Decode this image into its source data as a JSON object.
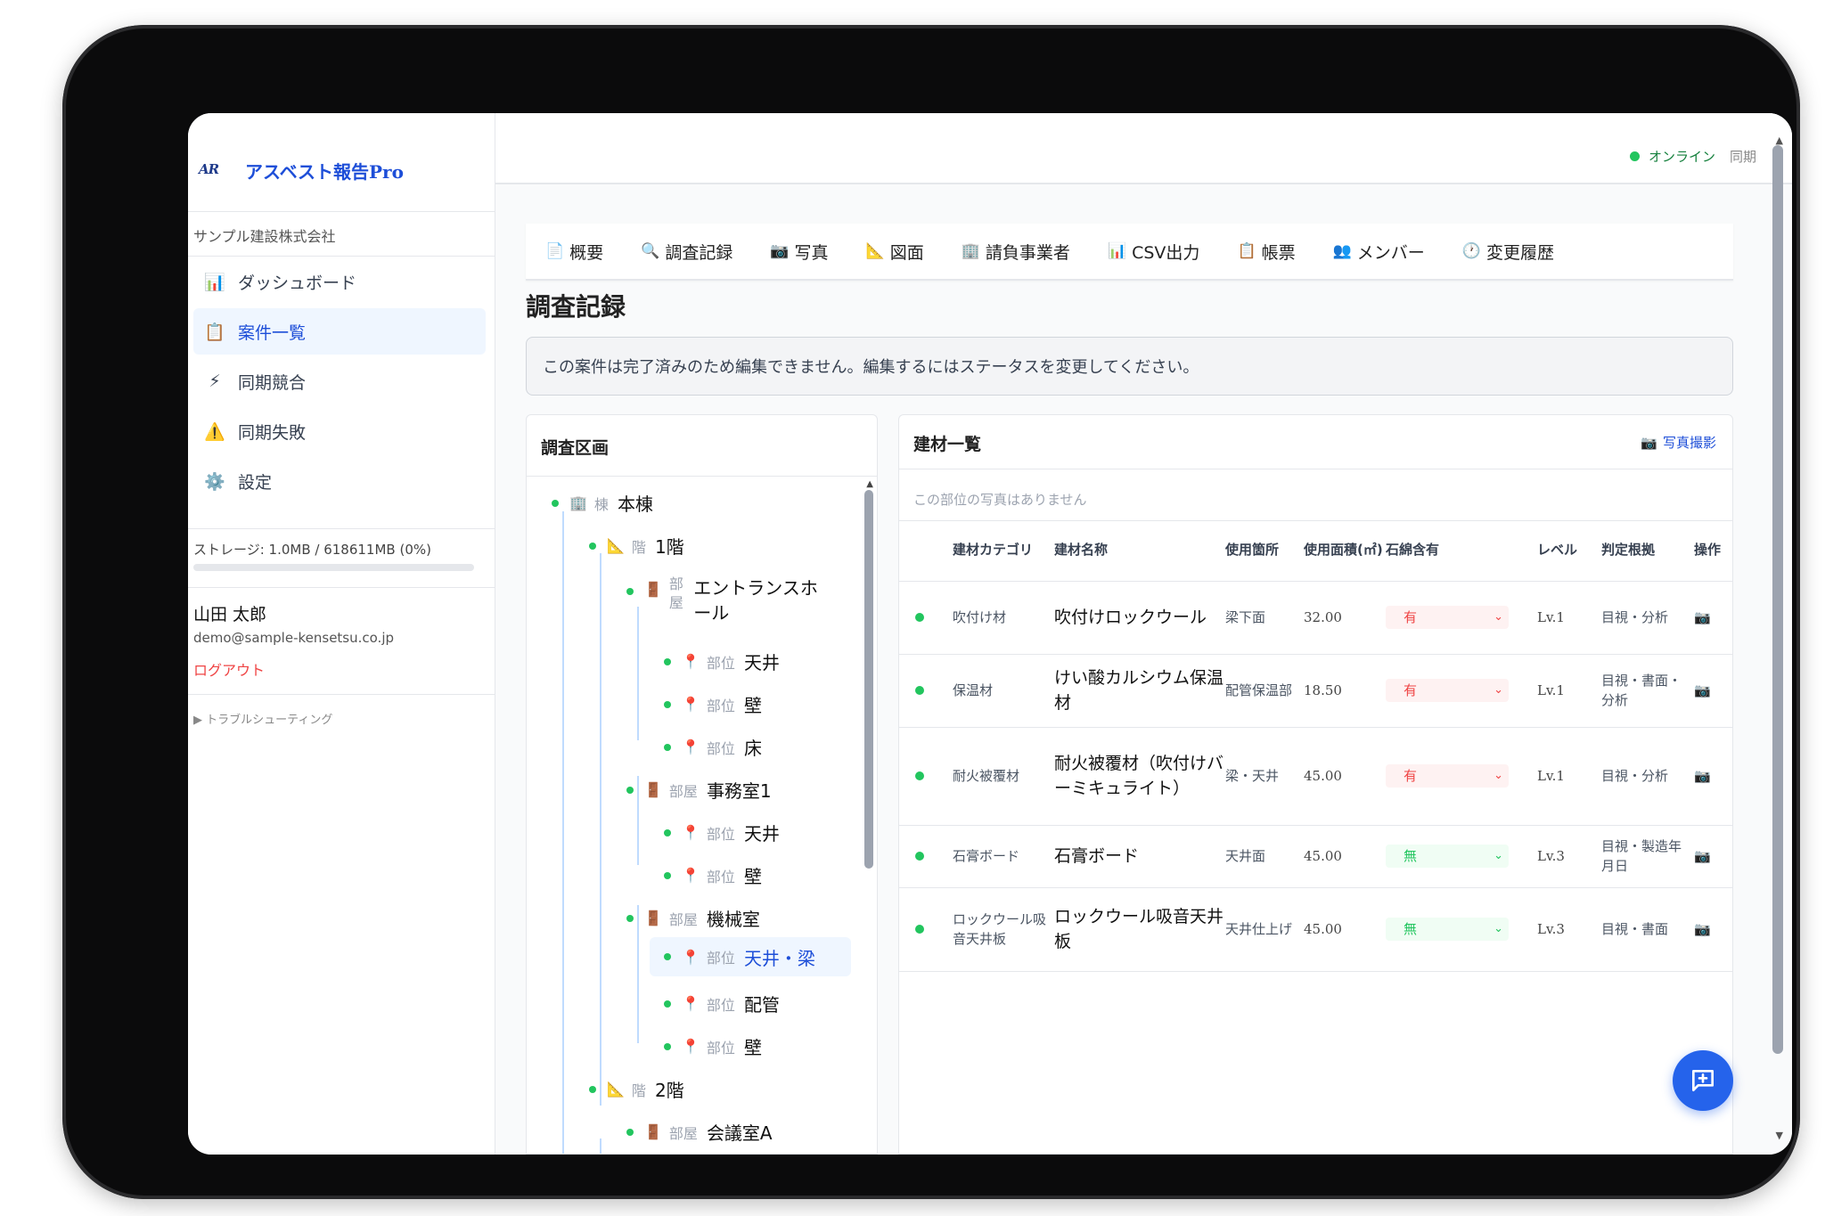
{
  "app": {
    "brand_logo": "AR",
    "brand_name": "アスベスト報告Pro",
    "company": "サンプル建設株式会社"
  },
  "sidebar": {
    "items": [
      {
        "icon": "📊",
        "label": "ダッシュボード"
      },
      {
        "icon": "📋",
        "label": "案件一覧"
      },
      {
        "icon": "⚡",
        "label": "同期競合"
      },
      {
        "icon": "⚠️",
        "label": "同期失敗"
      },
      {
        "icon": "⚙️",
        "label": "設定"
      }
    ],
    "storage": "ストレージ: 1.0MB / 618611MB (0%)",
    "storage_pct": 0,
    "user_name": "山田 太郎",
    "user_email": "demo@sample-kensetsu.co.jp",
    "logout": "ログアウト",
    "troubleshooting": "▶ トラブルシューティング"
  },
  "status": {
    "online": "オンライン",
    "sync": "同期"
  },
  "tabs": [
    {
      "icon": "📄",
      "label": "概要"
    },
    {
      "icon": "🔍",
      "label": "調査記録"
    },
    {
      "icon": "📷",
      "label": "写真"
    },
    {
      "icon": "📐",
      "label": "図面"
    },
    {
      "icon": "🏢",
      "label": "請負事業者"
    },
    {
      "icon": "📊",
      "label": "CSV出力"
    },
    {
      "icon": "📋",
      "label": "帳票"
    },
    {
      "icon": "👥",
      "label": "メンバー"
    },
    {
      "icon": "🕐",
      "label": "変更履歴"
    }
  ],
  "page": {
    "title": "調査記録",
    "notice": "この案件は完了済みのため編集できません。編集するにはステータスを変更してください。"
  },
  "tree": {
    "title": "調査区画",
    "nodes": [
      {
        "icon": "🏢",
        "type": "棟",
        "label": "本棟"
      },
      {
        "icon": "📐",
        "type": "階",
        "label": "1階"
      },
      {
        "icon": "🚪",
        "type": "部屋",
        "label": "エントランスホール"
      },
      {
        "icon": "📍",
        "type": "部位",
        "label": "天井"
      },
      {
        "icon": "📍",
        "type": "部位",
        "label": "壁"
      },
      {
        "icon": "📍",
        "type": "部位",
        "label": "床"
      },
      {
        "icon": "🚪",
        "type": "部屋",
        "label": "事務室1"
      },
      {
        "icon": "📍",
        "type": "部位",
        "label": "天井"
      },
      {
        "icon": "📍",
        "type": "部位",
        "label": "壁"
      },
      {
        "icon": "🚪",
        "type": "部屋",
        "label": "機械室"
      },
      {
        "icon": "📍",
        "type": "部位",
        "label": "天井・梁"
      },
      {
        "icon": "📍",
        "type": "部位",
        "label": "配管"
      },
      {
        "icon": "📍",
        "type": "部位",
        "label": "壁"
      },
      {
        "icon": "📐",
        "type": "階",
        "label": "2階"
      },
      {
        "icon": "🚪",
        "type": "部屋",
        "label": "会議室A"
      }
    ]
  },
  "materials": {
    "title": "建材一覧",
    "photo_button": "写真撮影",
    "no_photo": "この部位の写真はありません",
    "headers": [
      "建材カテゴリ",
      "建材名称",
      "使用箇所",
      "使用面積(㎡)",
      "石綿含有",
      "レベル",
      "判定根拠",
      "操作"
    ],
    "rows": [
      {
        "category": "吹付け材",
        "name": "吹付けロックウール",
        "location": "梁下面",
        "area": "32.00",
        "asbestos": "有",
        "level": "Lv.1",
        "basis": "目視・分析"
      },
      {
        "category": "保温材",
        "name": "けい酸カルシウム保温材",
        "location": "配管保温部",
        "area": "18.50",
        "asbestos": "有",
        "level": "Lv.1",
        "basis": "目視・書面・分析"
      },
      {
        "category": "耐火被覆材",
        "name": "耐火被覆材（吹付けバーミキュライト）",
        "location": "梁・天井",
        "area": "45.00",
        "asbestos": "有",
        "level": "Lv.1",
        "basis": "目視・分析"
      },
      {
        "category": "石膏ボード",
        "name": "石膏ボード",
        "location": "天井面",
        "area": "45.00",
        "asbestos": "無",
        "level": "Lv.3",
        "basis": "目視・製造年月日"
      },
      {
        "category": "ロックウール吸音天井板",
        "name": "ロックウール吸音天井板",
        "location": "天井仕上げ",
        "area": "45.00",
        "asbestos": "無",
        "level": "Lv.3",
        "basis": "目視・書面"
      }
    ]
  }
}
